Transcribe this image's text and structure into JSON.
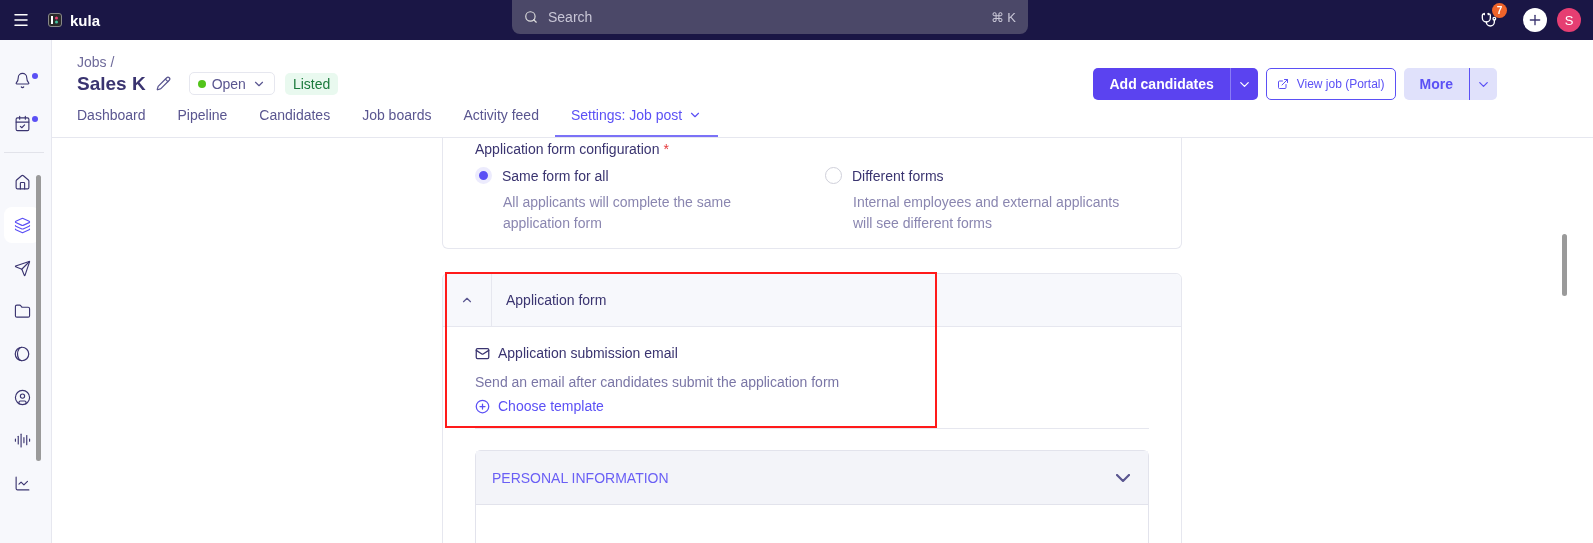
{
  "topbar": {
    "brand": "kula",
    "search": {
      "placeholder": "Search",
      "shortcut": "⌘ K"
    },
    "notification_count": "7",
    "avatar": "S"
  },
  "sidebar": {
    "items": [
      {
        "kind": "bell",
        "dot": true,
        "selected": false
      },
      {
        "kind": "calendar",
        "dot": true,
        "selected": false
      },
      {
        "kind": "home",
        "dot": false,
        "selected": false
      },
      {
        "kind": "layers",
        "dot": false,
        "selected": true
      },
      {
        "kind": "send",
        "dot": false,
        "selected": false
      },
      {
        "kind": "folder",
        "dot": false,
        "selected": false
      },
      {
        "kind": "half",
        "dot": false,
        "selected": false
      },
      {
        "kind": "user",
        "dot": false,
        "selected": false
      },
      {
        "kind": "audio",
        "dot": false,
        "selected": false
      },
      {
        "kind": "chart",
        "dot": false,
        "selected": false
      }
    ]
  },
  "header": {
    "breadcrumb": "Jobs /",
    "title": "Sales K",
    "status": {
      "label": "Open",
      "color": "#52c41a"
    },
    "badge": "Listed",
    "actions": {
      "primary": "Add candidates",
      "portal": "View job (Portal)",
      "more": "More"
    }
  },
  "tabs": [
    {
      "label": "Dashboard",
      "selected": false,
      "dropdown": false
    },
    {
      "label": "Pipeline",
      "selected": false,
      "dropdown": false
    },
    {
      "label": "Candidates",
      "selected": false,
      "dropdown": false
    },
    {
      "label": "Job boards",
      "selected": false,
      "dropdown": false
    },
    {
      "label": "Activity feed",
      "selected": false,
      "dropdown": false
    },
    {
      "label": "Settings: Job post",
      "selected": true,
      "dropdown": true
    }
  ],
  "config": {
    "label": "Application form configuration",
    "required_mark": "*",
    "options": [
      {
        "label": "Same form for all",
        "description": "All applicants will complete the same application form",
        "selected": true
      },
      {
        "label": "Different forms",
        "description": "Internal employees and external applicants will see different forms",
        "selected": false
      }
    ]
  },
  "application_form": {
    "title": "Application form",
    "expanded": true,
    "highlighted": true,
    "email": {
      "title": "Application submission email",
      "description": "Send an email after candidates submit the application form",
      "link": "Choose template"
    },
    "sections": [
      {
        "title": "PERSONAL INFORMATION",
        "expanded": false
      }
    ]
  }
}
